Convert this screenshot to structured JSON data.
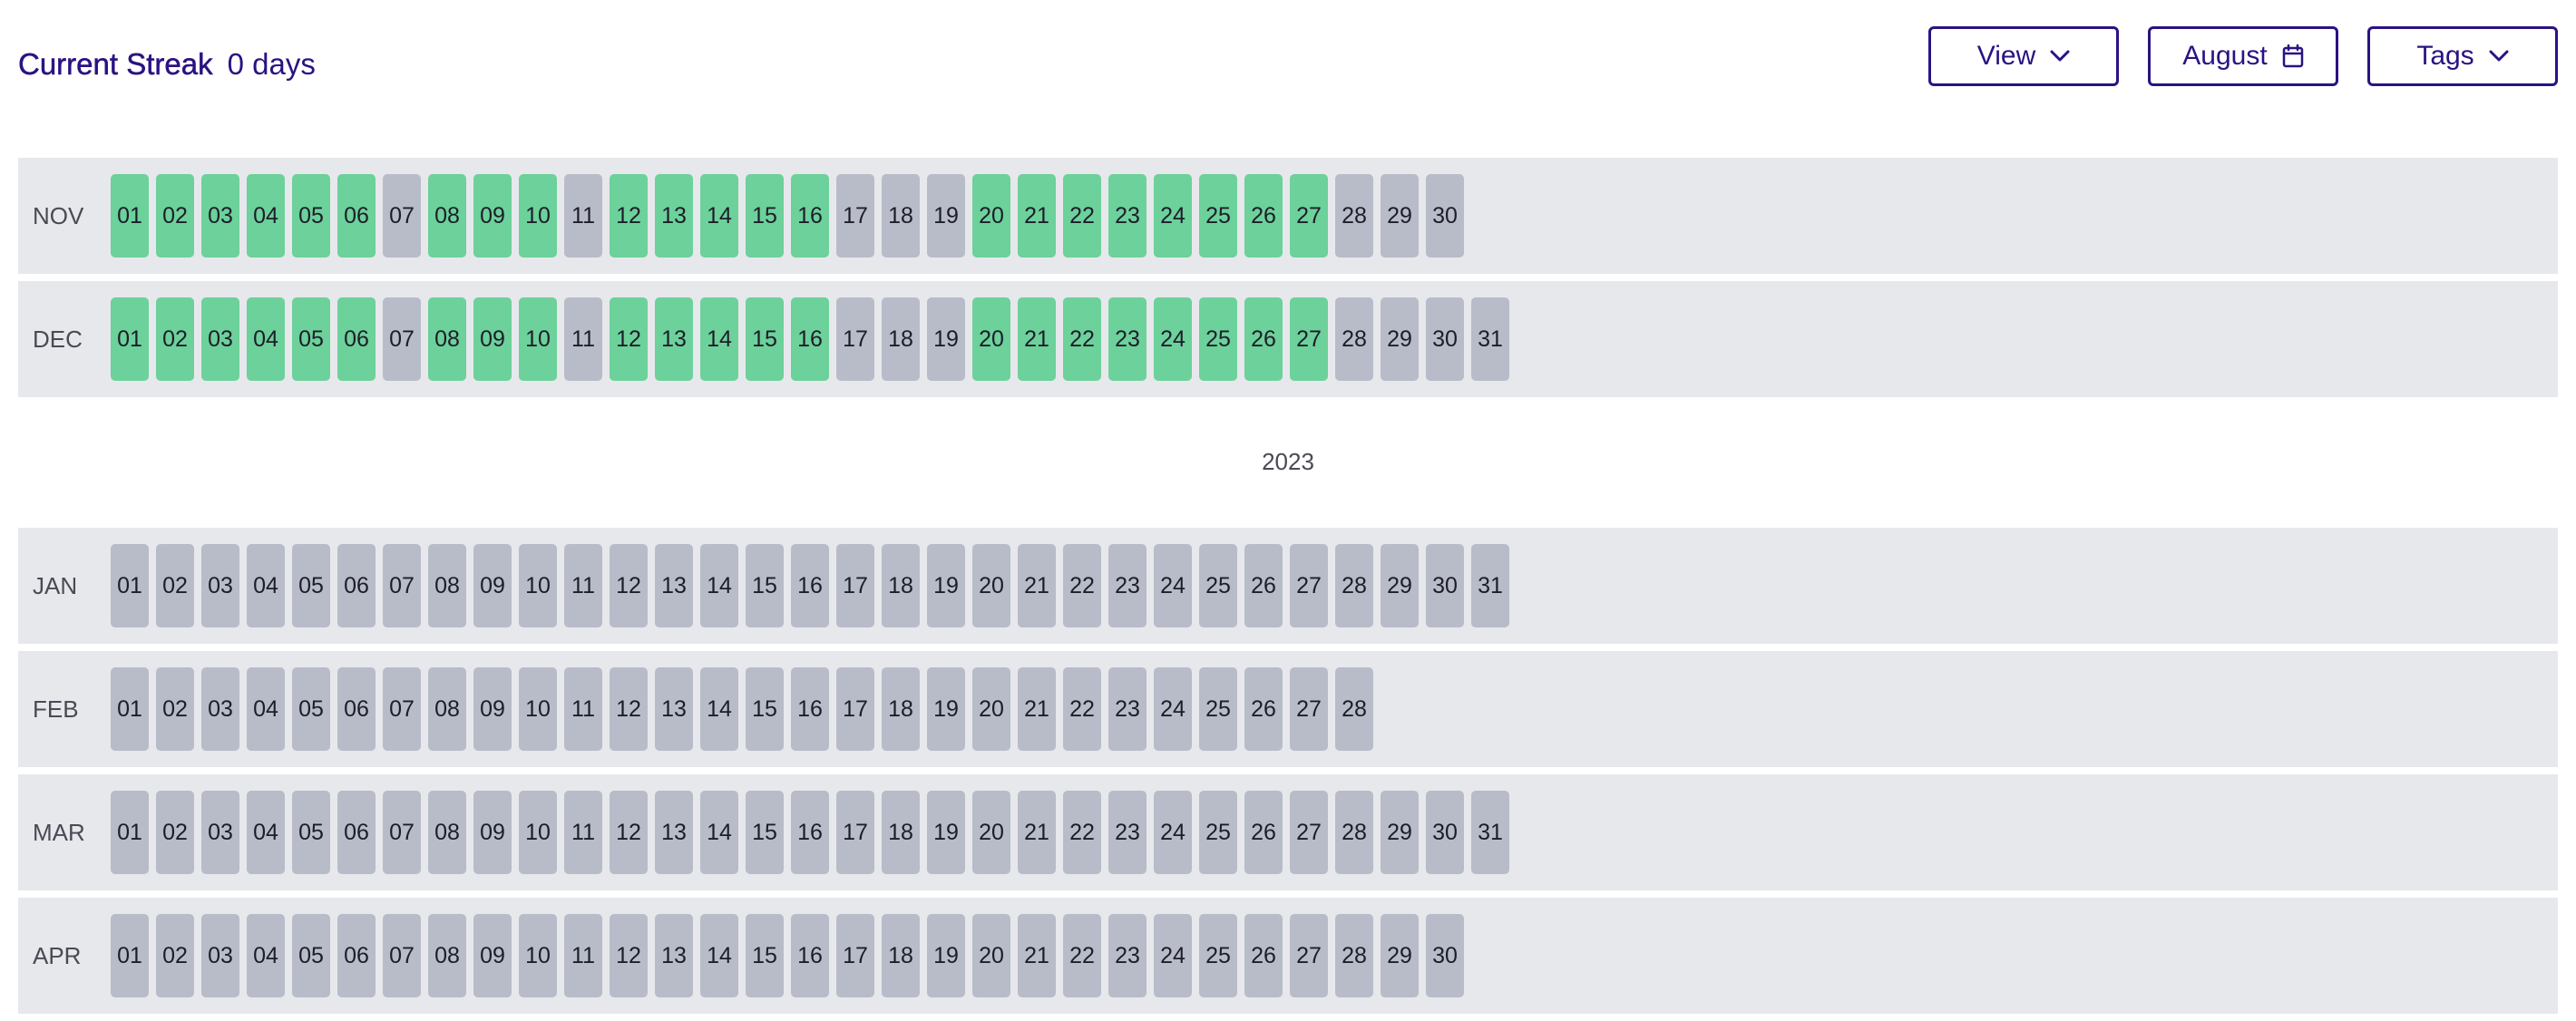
{
  "header": {
    "streak_label": "Current Streak",
    "streak_value": "0 days",
    "view_button": "View",
    "month_button": "August",
    "tags_button": "Tags"
  },
  "colors": {
    "accent": "#2b1282",
    "done": "#6cd19a",
    "missed": "#b8bcc9",
    "row_bg": "#e7e8ec"
  },
  "sections": [
    {
      "year_label": "",
      "months": [
        {
          "name": "NOV",
          "days": 30,
          "done": [
            1,
            2,
            3,
            4,
            5,
            6,
            8,
            9,
            10,
            12,
            13,
            14,
            15,
            16,
            20,
            21,
            22,
            23,
            24,
            25,
            26,
            27
          ]
        },
        {
          "name": "DEC",
          "days": 31,
          "done": [
            1,
            2,
            3,
            4,
            5,
            6,
            8,
            9,
            10,
            12,
            13,
            14,
            15,
            16,
            20,
            21,
            22,
            23,
            24,
            25,
            26,
            27
          ]
        }
      ]
    },
    {
      "year_label": "2023",
      "months": [
        {
          "name": "JAN",
          "days": 31,
          "done": []
        },
        {
          "name": "FEB",
          "days": 28,
          "done": []
        },
        {
          "name": "MAR",
          "days": 31,
          "done": []
        },
        {
          "name": "APR",
          "days": 30,
          "done": []
        }
      ]
    }
  ]
}
